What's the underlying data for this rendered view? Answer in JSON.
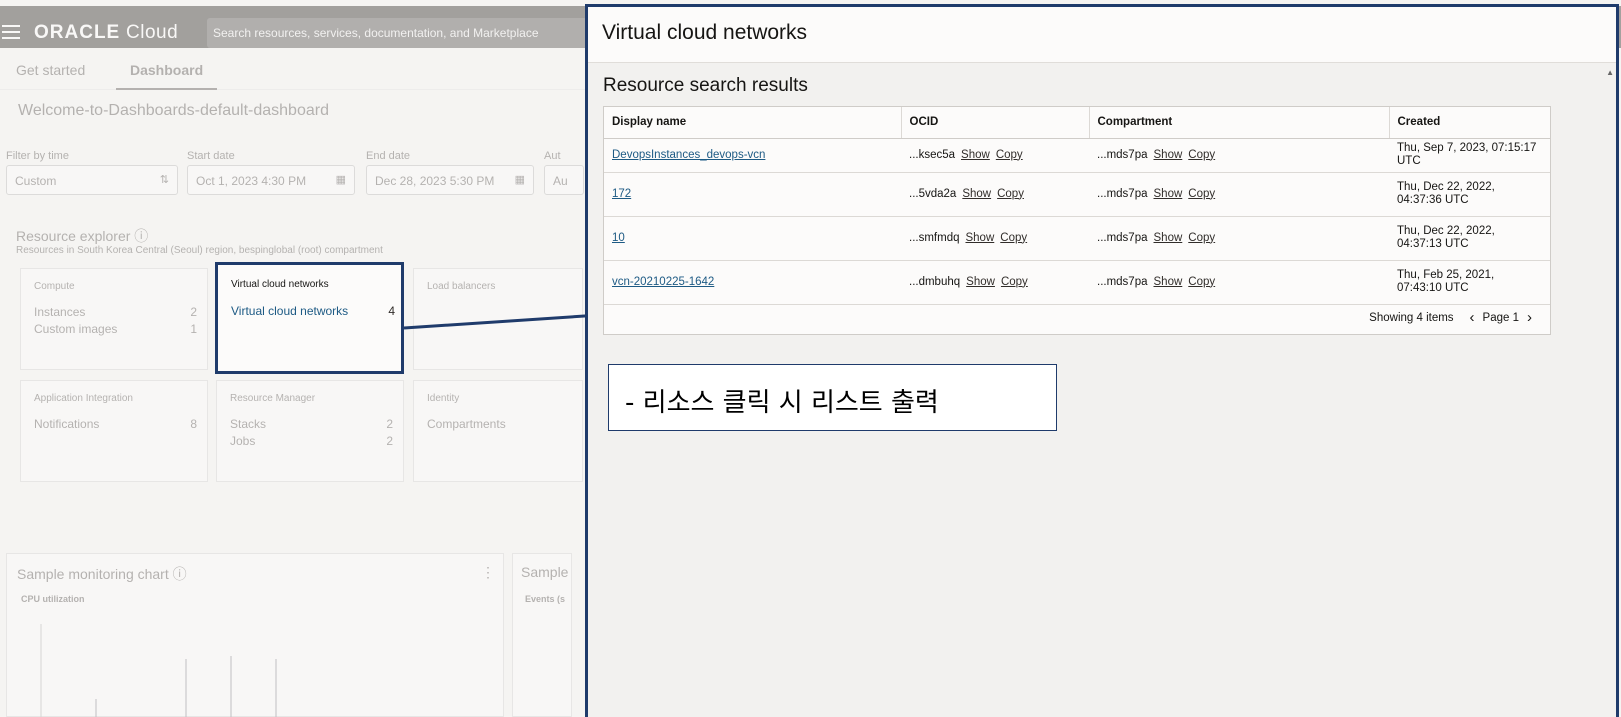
{
  "background": {
    "logo": {
      "oracle": "ORACLE",
      "cloud": "Cloud"
    },
    "search_placeholder": "Search resources, services, documentation, and Marketplace",
    "tabs": [
      {
        "label": "Get started"
      },
      {
        "label": "Dashboard"
      }
    ],
    "dashboard_title": "Welcome-to-Dashboards-default-dashboard",
    "filters": {
      "time_label": "Filter by time",
      "time_value": "Custom",
      "start_label": "Start date",
      "start_value": "Oct 1, 2023 4:30 PM",
      "end_label": "End date",
      "end_value": "Dec 28, 2023 5:30 PM",
      "auto_label": "Aut",
      "auto_value": "Au"
    },
    "resource_explorer": {
      "title": "Resource explorer",
      "subtitle": "Resources in South Korea Central (Seoul) region, bespinglobal (root) compartment"
    },
    "cards": {
      "compute": {
        "title": "Compute",
        "rows": [
          {
            "label": "Instances",
            "count": "2"
          },
          {
            "label": "Custom images",
            "count": "1"
          }
        ]
      },
      "vcn": {
        "title": "Virtual cloud networks",
        "rows": [
          {
            "label": "Virtual cloud networks",
            "count": "4"
          }
        ]
      },
      "lb": {
        "title": "Load balancers"
      },
      "app": {
        "title": "Application Integration",
        "rows": [
          {
            "label": "Notifications",
            "count": "8"
          }
        ]
      },
      "rm": {
        "title": "Resource Manager",
        "rows": [
          {
            "label": "Stacks",
            "count": "2"
          },
          {
            "label": "Jobs",
            "count": "2"
          }
        ]
      },
      "identity": {
        "title": "Identity",
        "rows": [
          {
            "label": "Compartments"
          }
        ]
      }
    },
    "monitoring": {
      "title": "Sample monitoring chart",
      "metric": "CPU utilization",
      "title2": "Sample",
      "metric2": "Events (s"
    }
  },
  "panel": {
    "title": "Virtual cloud networks",
    "section_title": "Resource search results",
    "columns": [
      "Display name",
      "OCID",
      "Compartment",
      "Created"
    ],
    "rows": [
      {
        "name": "DevopsInstances_devops-vcn",
        "ocid": "...ksec5a",
        "compartment": "...mds7pa",
        "created": "Thu, Sep 7, 2023, 07:15:17 UTC"
      },
      {
        "name": "172",
        "ocid": "...5vda2a",
        "compartment": "...mds7pa",
        "created": "Thu, Dec 22, 2022, 04:37:36 UTC"
      },
      {
        "name": "10",
        "ocid": "...smfmdq",
        "compartment": "...mds7pa",
        "created": "Thu, Dec 22, 2022, 04:37:13 UTC"
      },
      {
        "name": "vcn-20210225-1642",
        "ocid": "...dmbuhq",
        "compartment": "...mds7pa",
        "created": "Thu, Feb 25, 2021, 07:43:10 UTC"
      }
    ],
    "show_label": "Show",
    "copy_label": "Copy",
    "showing": "Showing 4 items",
    "page": "Page 1"
  },
  "annotation": "- 리소스 클릭 시 리스트 출력",
  "colors": {
    "highlight": "#1f3b6b",
    "link": "#1d5a84"
  }
}
